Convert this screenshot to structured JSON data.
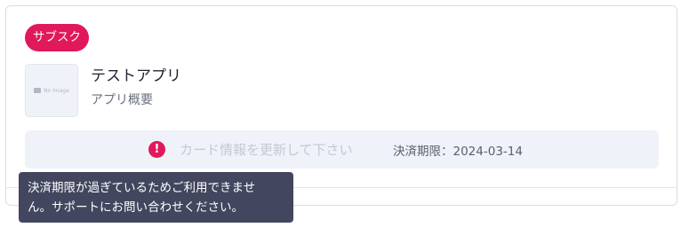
{
  "card": {
    "badge": "サブスク",
    "thumbnail_icon": "image-icon",
    "thumbnail_text": "No Image",
    "app_title": "テストアプリ",
    "app_description": "アプリ概要"
  },
  "notice": {
    "icon": "exclamation-icon",
    "alert_glyph": "!",
    "message": "カード情報を更新して下さい",
    "expiry": "決済期限：2024-03-14"
  },
  "tooltip": {
    "line1": "決済期限が過ぎているためご利用できませ",
    "line2": "ん。サポートにお問い合わせください。"
  },
  "colors": {
    "accent": "#e0195a",
    "notice_bg": "#eff2f9",
    "tooltip_bg": "#42465e"
  }
}
